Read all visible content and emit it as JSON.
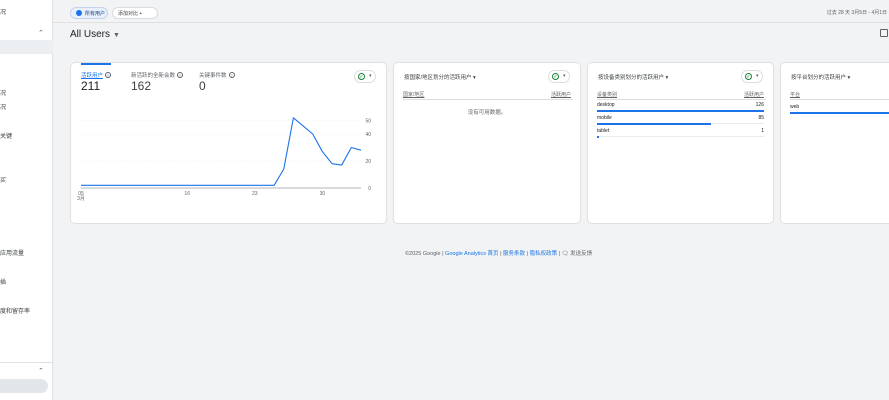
{
  "sidebar": {
    "items": [
      {
        "label": "况"
      },
      {
        "label": "况"
      },
      {
        "label": "况"
      },
      {
        "label": "关键"
      },
      {
        "label": "买"
      },
      {
        "label": "应用流量"
      },
      {
        "label": "插"
      },
      {
        "label": "度和留存率"
      }
    ]
  },
  "topbar": {
    "active_chip": "所有用户",
    "add_chip": "添加对比 +",
    "date_range": "过去 28 天   3月5日 - 4月1日"
  },
  "audience": {
    "label": "All Users",
    "caret": "▼"
  },
  "main_card": {
    "metrics": [
      {
        "label": "活跃用户",
        "value": "211"
      },
      {
        "label": "新活跃的全新会数",
        "value": "162"
      },
      {
        "label": "关键事件数",
        "value": "0"
      }
    ],
    "help_glyph": "?"
  },
  "chart_data": {
    "type": "line",
    "title": "",
    "xlabel": "",
    "ylabel": "",
    "x": [
      5,
      6,
      7,
      8,
      9,
      10,
      11,
      12,
      13,
      14,
      15,
      16,
      17,
      18,
      19,
      20,
      21,
      22,
      23,
      24,
      25,
      26,
      27,
      28,
      29,
      30,
      31,
      32
    ],
    "x_tick_labels": [
      "05\n3月",
      "16",
      "23",
      "30"
    ],
    "x_ticks": [
      5,
      16,
      23,
      30
    ],
    "y_tick_labels": [
      "50",
      "40",
      "20",
      "0"
    ],
    "y_ticks": [
      50,
      40,
      20,
      0
    ],
    "ylim": [
      0,
      60
    ],
    "series": [
      {
        "values": [
          2,
          2,
          2,
          2,
          2,
          2,
          2,
          2,
          2,
          2,
          2,
          2,
          2,
          2,
          2,
          2,
          2,
          2,
          2,
          2,
          2,
          14,
          52,
          46,
          40,
          27,
          18,
          17,
          30,
          28
        ]
      }
    ],
    "grid": true,
    "color": "#1a73e8"
  },
  "card_country": {
    "title": "按国家/地区划分的活跃用户 ▾",
    "col_left": "国家/地区",
    "col_right": "活跃用户",
    "no_data": "没有可用数据。"
  },
  "card_device": {
    "title": "按设备类别划分的活跃用户 ▾",
    "col_left": "设备类别",
    "col_right": "活跃用户",
    "rows": [
      {
        "label": "desktop",
        "value": "126",
        "fraction": 1.0
      },
      {
        "label": "mobile",
        "value": "85",
        "fraction": 0.68
      },
      {
        "label": "tablet",
        "value": "1",
        "fraction": 0.01
      }
    ]
  },
  "card_platform": {
    "title": "按平台划分的活跃用户 ▾",
    "col_left": "平台",
    "rows": [
      {
        "label": "web"
      }
    ]
  },
  "status": {
    "check": "✓",
    "dropdown": "▾"
  },
  "footer": {
    "copyright": "©2025 Google | ",
    "link1": "Google Analytics 首页",
    "sep": " | ",
    "link2": "服务条款",
    "link3": "隐私权政策",
    "feedback": " | 🗨 发送反馈"
  },
  "colors": {
    "accent": "#1a73e8",
    "good": "#188038"
  }
}
